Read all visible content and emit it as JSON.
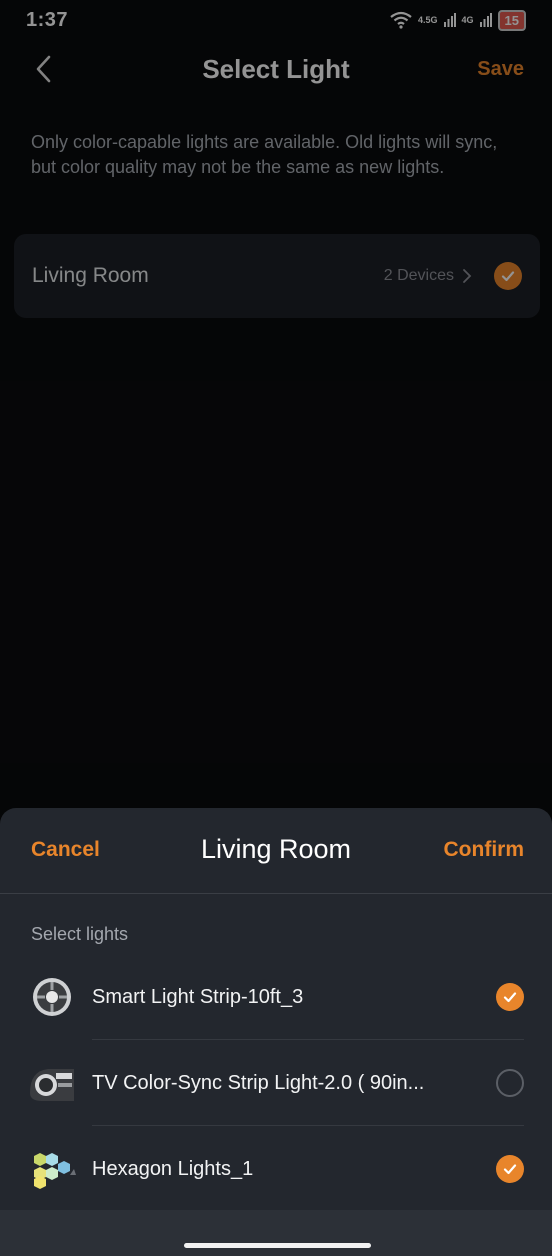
{
  "status_bar": {
    "time": "1:37",
    "net1": "4.5G",
    "net2": "4G",
    "battery": "15"
  },
  "header": {
    "title": "Select Light",
    "save_label": "Save"
  },
  "description": "Only color-capable lights are available. Old lights will sync, but color quality may not be the same as new lights.",
  "room": {
    "name": "Living Room",
    "devices": "2 Devices",
    "selected": true
  },
  "sheet": {
    "cancel_label": "Cancel",
    "title": "Living Room",
    "confirm_label": "Confirm",
    "section_label": "Select lights",
    "items": [
      {
        "name": "Smart Light Strip-10ft_3",
        "selected": true,
        "icon": "light-strip-reel-icon"
      },
      {
        "name": "TV Color-Sync Strip Light-2.0 ( 90in...",
        "selected": false,
        "icon": "tv-strip-icon"
      },
      {
        "name": "Hexagon Lights_1",
        "selected": true,
        "icon": "hexagon-lights-icon"
      }
    ]
  },
  "colors": {
    "accent": "#e8852b",
    "sheet_bg": "#23272e",
    "card_bg": "#1d2026"
  }
}
